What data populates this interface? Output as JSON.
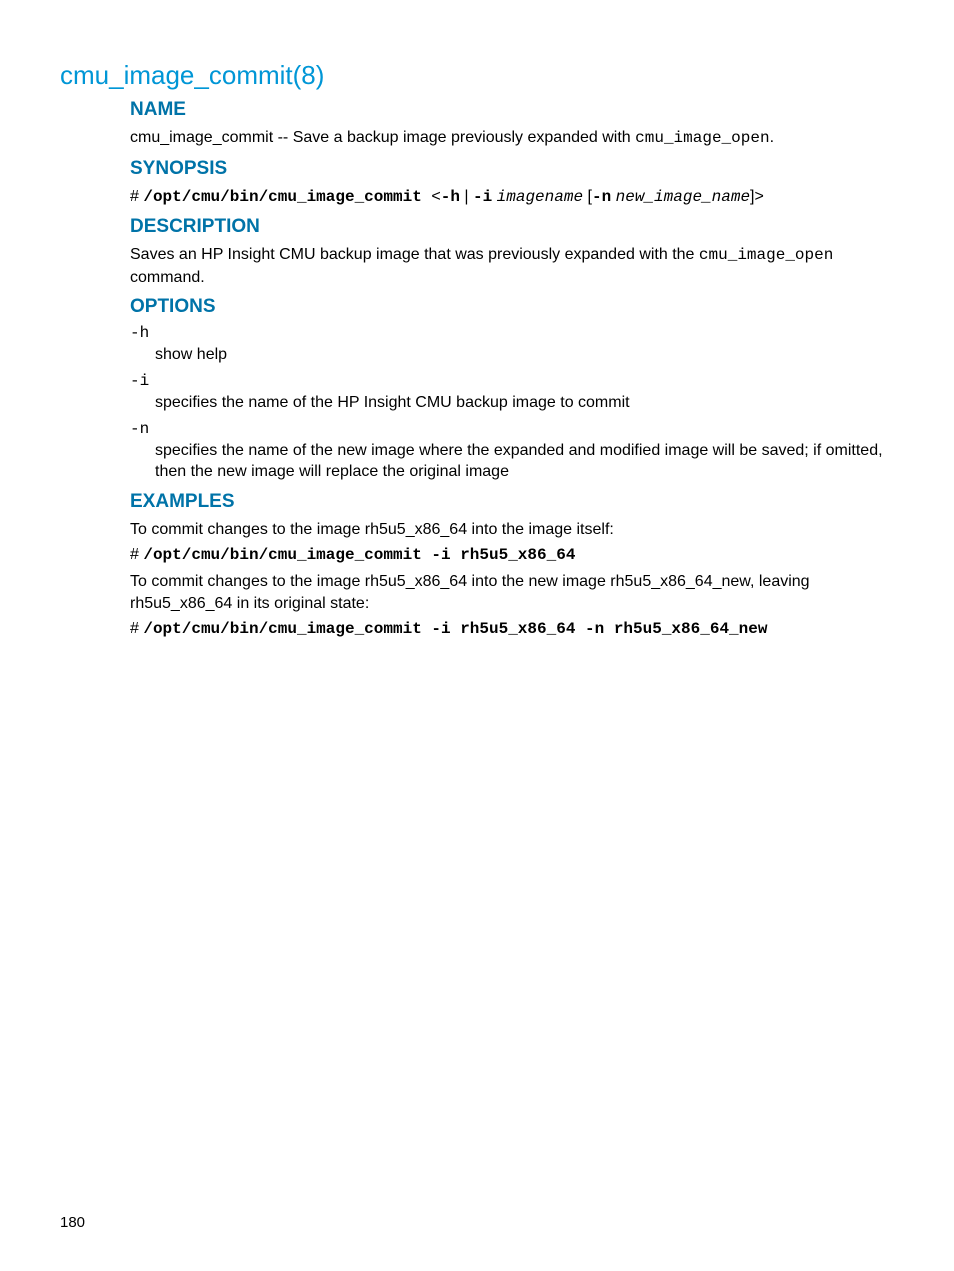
{
  "title": "cmu_image_commit(8)",
  "sections": {
    "name": {
      "heading": "NAME",
      "prefix": "cmu_image_commit -- Save a backup image previously expanded with ",
      "code": "cmu_image_open",
      "suffix": "."
    },
    "synopsis": {
      "heading": "SYNOPSIS",
      "prompt": "# ",
      "cmd": "/opt/cmu/bin/cmu_image_commit ",
      "lt": "<",
      "opt_h": "-h",
      "pipe": " | ",
      "opt_i": "-i",
      "space1": " ",
      "arg1": "imagename",
      "space2": " ",
      "lbrack": "[",
      "opt_n": "-n",
      "space3": " ",
      "arg2": "new_image_name",
      "rbrack": "]",
      "gt": ">"
    },
    "description": {
      "heading": "DESCRIPTION",
      "prefix": "Saves an HP Insight CMU backup image that was previously expanded with the ",
      "code": "cmu_image_open",
      "suffix": " command."
    },
    "options": {
      "heading": "OPTIONS",
      "items": [
        {
          "term": "-h",
          "desc": "show help"
        },
        {
          "term": "-i",
          "desc": "specifies the name of the HP Insight CMU backup image to commit"
        },
        {
          "term": "-n",
          "desc": "specifies the name of the new image where the expanded and modified image will be saved; if omitted, then the new image will replace the original image"
        }
      ]
    },
    "examples": {
      "heading": "EXAMPLES",
      "ex1_text": "To commit changes to the image rh5u5_x86_64 into the image itself:",
      "ex1_prompt": "# ",
      "ex1_cmd": "/opt/cmu/bin/cmu_image_commit -i rh5u5_x86_64",
      "ex2_text": "To commit changes to the image rh5u5_x86_64 into the new image rh5u5_x86_64_new, leaving rh5u5_x86_64 in its original state:",
      "ex2_prompt": "# ",
      "ex2_cmd": "/opt/cmu/bin/cmu_image_commit -i rh5u5_x86_64 -n rh5u5_x86_64_new"
    }
  },
  "page_number": "180"
}
